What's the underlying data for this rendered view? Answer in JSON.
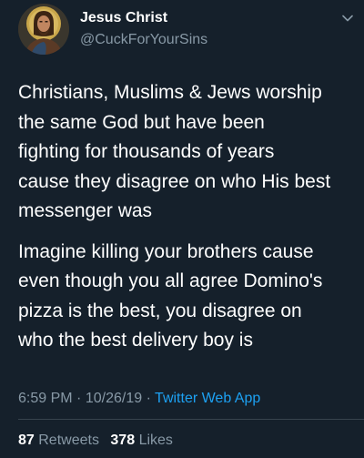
{
  "colors": {
    "background": "#15202b",
    "text": "#ffffff",
    "muted": "#8899a6",
    "link": "#1da1f2",
    "divider": "#38444d"
  },
  "user": {
    "display_name": "Jesus Christ",
    "handle": "@CuckForYourSins",
    "avatar_icon": "jesus-portrait-avatar"
  },
  "tweet": {
    "paragraphs": [
      "Christians, Muslims & Jews worship\nthe same God but have been\nfighting for thousands of years\ncause they disagree on who His best\nmessenger was",
      "Imagine killing your brothers cause\neven though you all agree Domino's\npizza is the best, you disagree on\nwho the best delivery boy is"
    ],
    "time": "6:59 PM",
    "date": "10/26/19",
    "separator": "·",
    "source": "Twitter Web App"
  },
  "stats": {
    "retweets_count": "87",
    "retweets_label": "Retweets",
    "likes_count": "378",
    "likes_label": "Likes"
  },
  "icons": {
    "menu": "chevron-down-icon"
  }
}
